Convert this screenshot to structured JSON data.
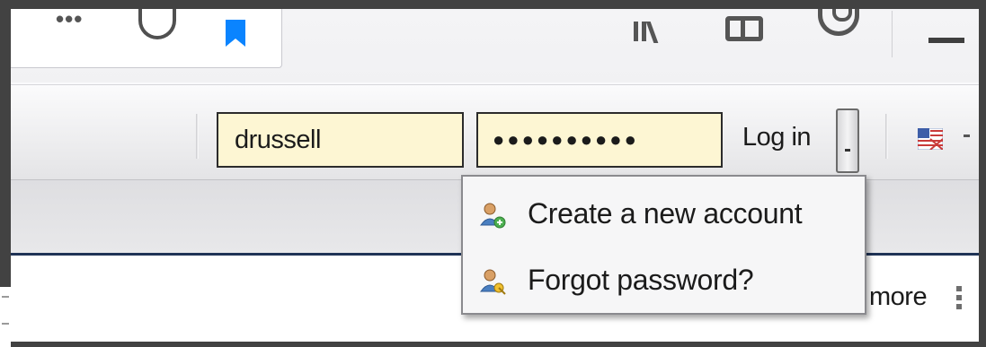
{
  "browser": {
    "url_overflow": "•••",
    "icons": [
      "pocket-icon",
      "bookmark-star-icon",
      "library-icon",
      "sidebar-icon",
      "account-icon",
      "minimize-icon"
    ]
  },
  "login": {
    "username": "drussell",
    "password": "●●●●●●●●●●",
    "login_label": "Log in"
  },
  "dropdown": {
    "items": [
      {
        "label": "Create a new account",
        "icon": "add-user-icon"
      },
      {
        "label": "Forgot password?",
        "icon": "key-user-icon"
      }
    ]
  },
  "content": {
    "more_label": "more"
  },
  "colors": {
    "field_bg": "#fdf6d3",
    "content_border": "#1f3356",
    "bookmark_blue": "#0a84ff"
  }
}
